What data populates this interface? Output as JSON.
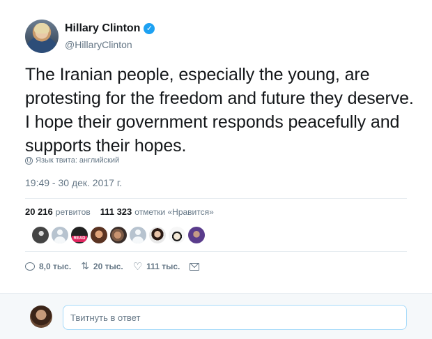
{
  "author": {
    "name": "Hillary Clinton",
    "verified": true,
    "handle": "@HillaryClinton"
  },
  "tweet": {
    "text": "The Iranian people, especially the young, are protesting for the freedom and future they deserve. I hope their government responds peacefully and supports their hopes.",
    "language_note": "Язык твита: английский",
    "timestamp": "19:49 - 30 дек. 2017 г."
  },
  "stats": {
    "retweets_count": "20 216",
    "retweets_label": "ретвитов",
    "likes_count": "111 323",
    "likes_label": "отметки «Нравится»"
  },
  "likers": {
    "overlay_badge": "READ"
  },
  "actions": {
    "reply_count": "8,0 тыс.",
    "retweet_count": "20 тыс.",
    "like_count": "111 тыс."
  },
  "reply_box": {
    "placeholder": "Твитнуть в ответ"
  },
  "icons": [
    "verified-icon",
    "globe-icon",
    "reply-icon",
    "retweet-icon",
    "like-icon",
    "direct-message-icon"
  ],
  "colors": {
    "accent": "#1da1f2",
    "muted_text": "#657786",
    "text": "#14171a",
    "background_alt": "#f5f8fa"
  }
}
